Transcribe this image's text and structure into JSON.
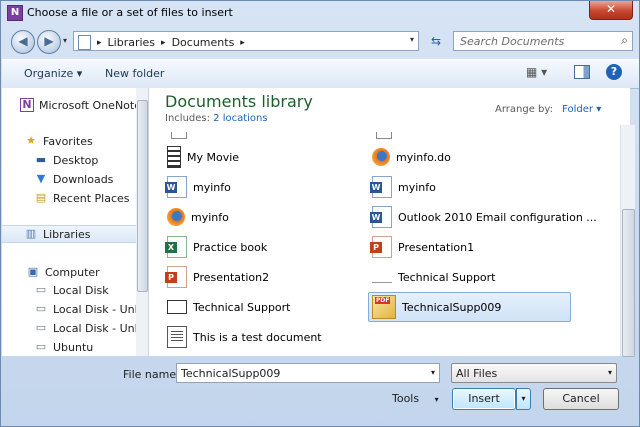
{
  "window": {
    "title": "Choose a file or a set of files to insert",
    "close_glyph": "✕",
    "app_icon_letter": "N"
  },
  "nav": {
    "back_glyph": "◀",
    "forward_glyph": "▶",
    "dropdown_glyph": "▾",
    "breadcrumbs": [
      "Libraries",
      "Documents"
    ],
    "separator": "▸",
    "refresh_glyph": "⇆",
    "search_placeholder": "Search Documents",
    "search_glyph": "⌕"
  },
  "toolbar": {
    "organize": "Organize ▾",
    "new_folder": "New folder",
    "views_glyph": "▦ ▾",
    "help_glyph": "?"
  },
  "sidebar": {
    "items": [
      {
        "label": "Microsoft OneNote",
        "icon": "onenote-icon",
        "glyph": "N"
      },
      {
        "label": "Favorites",
        "icon": "star-icon",
        "glyph": "★"
      },
      {
        "label": "Desktop",
        "icon": "desktop-icon",
        "glyph": "▬"
      },
      {
        "label": "Downloads",
        "icon": "downloads-icon",
        "glyph": "▼"
      },
      {
        "label": "Recent Places",
        "icon": "recent-places-icon",
        "glyph": "▤"
      },
      {
        "label": "Libraries",
        "icon": "libraries-icon",
        "glyph": "▥"
      },
      {
        "label": "Computer",
        "icon": "computer-icon",
        "glyph": "▣"
      },
      {
        "label": "Local Disk",
        "icon": "local-disk-icon",
        "glyph": "▭"
      },
      {
        "label": "Local Disk - Unla",
        "icon": "drive-icon",
        "glyph": "▭"
      },
      {
        "label": "Local Disk - Unla",
        "icon": "drive-icon",
        "glyph": "▭"
      },
      {
        "label": "Ubuntu",
        "icon": "drive-icon",
        "glyph": "▭"
      }
    ]
  },
  "library": {
    "title": "Documents library",
    "includes_label": "Includes:",
    "includes_link": "2 locations",
    "arrange_label": "Arrange by:",
    "arrange_value": "Folder ▾"
  },
  "files": {
    "left": [
      {
        "name": "My Movie",
        "icon": "movie-icon"
      },
      {
        "name": "myinfo",
        "icon": "word-icon"
      },
      {
        "name": "myinfo",
        "icon": "firefox-icon"
      },
      {
        "name": "Practice book",
        "icon": "excel-icon"
      },
      {
        "name": "Presentation2",
        "icon": "powerpoint-icon"
      },
      {
        "name": "Technical Support",
        "icon": "video-icon"
      },
      {
        "name": "This is a test document",
        "icon": "document-icon"
      }
    ],
    "right": [
      {
        "name": "myinfo.do",
        "icon": "firefox-icon"
      },
      {
        "name": "myinfo",
        "icon": "word-icon"
      },
      {
        "name": "Outlook 2010 Email configuration ...",
        "icon": "word-icon"
      },
      {
        "name": "Presentation1",
        "icon": "powerpoint-icon"
      },
      {
        "name": "Technical Support",
        "icon": "blank-file-icon"
      },
      {
        "name": "TechnicalSupp009",
        "icon": "pdf-icon",
        "selected": true
      }
    ]
  },
  "footer": {
    "file_name_label": "File name:",
    "file_name_value": "TechnicalSupp009",
    "file_type_value": "All Files",
    "tools_label": "Tools",
    "insert_label": "Insert",
    "cancel_label": "Cancel",
    "dropdown_glyph": "▾"
  }
}
